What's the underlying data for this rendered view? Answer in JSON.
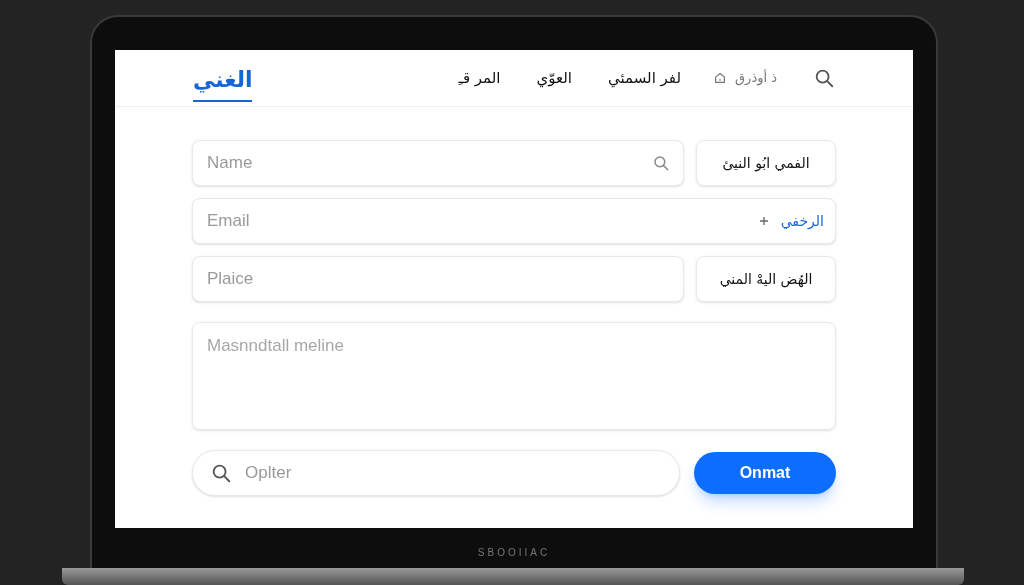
{
  "laptop": {
    "bezel_label": "SBOOIIAC"
  },
  "header": {
    "logo": "الغني",
    "nav": [
      {
        "label": "لفر السمئي"
      },
      {
        "label": "العوّي"
      },
      {
        "label": "المر قـِ"
      }
    ],
    "account": "ذ أوذرق"
  },
  "form": {
    "fields": [
      {
        "kind": "search_labeled",
        "placeholder": "Name",
        "label": "الفمي ابُو النيئ"
      },
      {
        "kind": "inline_action",
        "placeholder": "Email",
        "action": "الرخفي"
      },
      {
        "kind": "labeled",
        "placeholder": "Plaice",
        "label": "الهُض اليهْ المني"
      },
      {
        "kind": "textarea",
        "placeholder": "Masnndtall meline"
      }
    ],
    "search": {
      "placeholder": "Oplter"
    },
    "submit": "Onmat"
  }
}
